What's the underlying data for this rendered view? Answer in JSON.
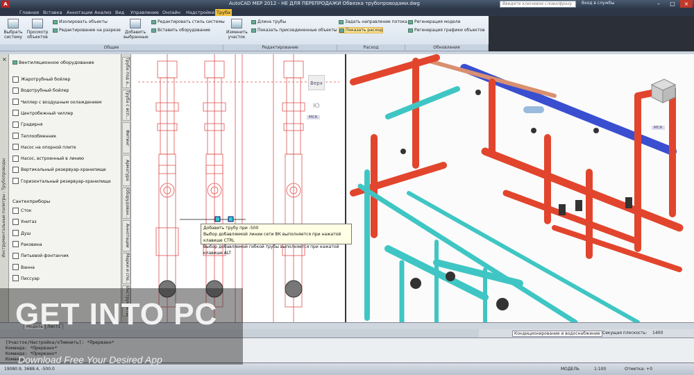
{
  "titlebar": {
    "title": "AutoCAD MEP 2012 - НЕ ДЛЯ ПЕРЕПРОДАЖИ   Обвязка трубопроводами.dwg",
    "search_placeholder": "Введите ключевое слово/фразу",
    "sign_in": "Вход в службы"
  },
  "tabs": [
    "Главная",
    "Вставка",
    "Аннотации",
    "Анализ",
    "Вид",
    "Управление",
    "Онлайн",
    "Надстройки",
    "Труба"
  ],
  "active_tab": "Труба",
  "ribbon": {
    "select_system": "Выбрать систему",
    "view_objects": "Просмотр объектов",
    "isolate_objects": "Изолировать объекты",
    "edit_in_section": "Редактирование на разрезе",
    "add_selected": "Добавить выбранные",
    "edit_system_style": "Редактировать стиль системы",
    "insert_equipment": "Вставить оборудование",
    "modify_run": "Изменить участок",
    "pipe_length": "Длина трубы",
    "show_connected": "Показать присоединенные объекты",
    "set_flow_direction": "Задать направление потока",
    "show_flow": "Показать расход",
    "regen_model": "Регенерация модели",
    "regen_graphics": "Регенерация графики объектов",
    "panels": [
      "Общие",
      "Редактирование",
      "Расход",
      "Обновления"
    ]
  },
  "palette": {
    "strip_title": "Инструментальные палитры - Трубопроводы",
    "section_equipment": "Вентиляционное оборудование",
    "equipment": [
      "Жаротрубный бойлер",
      "Водотрубный бойлер",
      "Чиллер с воздушным охлаждением",
      "Центробежный чиллер",
      "Градирня",
      "Теплообменник",
      "Насос на опорной плите",
      "Насос, встроенный в линию",
      "Вертикальный резервуар-хранилище",
      "Горизонтальный резервуар-хранилище"
    ],
    "section_plumbing": "Сантехприборы",
    "plumbing": [
      "Сток",
      "Унитаз",
      "Душ",
      "Раковина",
      "Питьевой фонтанчик",
      "Ванна",
      "Писсуар"
    ],
    "side_tabs": [
      "Труба под а...",
      "Труба с исп...",
      "Фитинг",
      "Арматура",
      "Оборудован...",
      "Аннотации",
      "Марки и спе...",
      "Инструменты"
    ]
  },
  "viewport2d": {
    "view_label": "Верх",
    "compass_s": "Ю",
    "ucs": "МСК"
  },
  "viewport3d": {
    "ucs": "МСК"
  },
  "tooltip": {
    "line1": "Добавить трубу при -500",
    "line2": "Выбор добавляемой линии сети ВК выполняется при нажатой клавише CTRL",
    "line3": "Выбор добавляемой гибкой трубы выполняется при нажатой клавише ALT"
  },
  "layouts": {
    "model": "Модель",
    "sheet": "Лист1"
  },
  "statusmid": {
    "system": "Кондиционирование и водоснабжение",
    "cut_plane": "Секущая плоскость:",
    "cut_value": "1400"
  },
  "command": {
    "line1": "[Участок/Настройка/оТменить]: *Прервано*",
    "line2": "Команда: *Прервано*",
    "line3": "Команда: *Прервано*",
    "line4": "Команда:"
  },
  "statusbar": {
    "coords": "19080.9, 3688.4, -500.0",
    "model": "МОДЕЛЬ",
    "scale": "1:100",
    "elevation": "Отметка: +0"
  },
  "watermark": {
    "title": "GET INTO PC",
    "subtitle": "Download Free Your Desired App"
  },
  "colors": {
    "accent": "#f0c040",
    "pipe_red": "#e2452d",
    "pipe_cyan": "#3fc6c4",
    "pipe_blue": "#3a4fd0",
    "plan_red": "#e05050"
  }
}
